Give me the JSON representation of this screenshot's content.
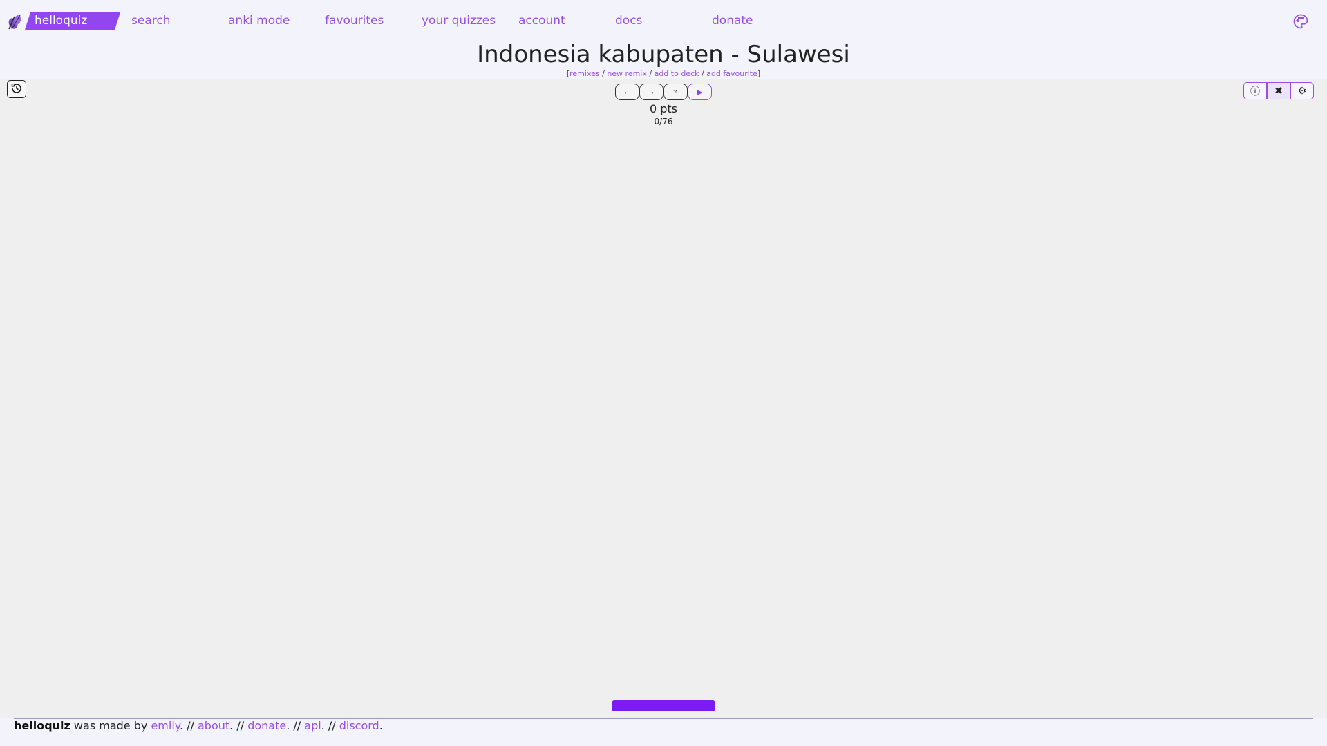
{
  "nav": {
    "brand": "helloquiz",
    "links": [
      "search",
      "anki mode",
      "favourites",
      "your quizzes",
      "account",
      "docs",
      "donate"
    ]
  },
  "quiz": {
    "title": "Indonesia kabupaten - Sulawesi",
    "links": {
      "open": "[",
      "remixes": "remixes",
      "sep1": " / ",
      "new_remix": "new remix",
      "sep2": " / ",
      "add_to_deck": "add to deck",
      "sep3": " / ",
      "add_favourite": "add favourite",
      "close": "]"
    },
    "controls": {
      "prev": "←",
      "next": "→",
      "skip": "»",
      "play": "▶"
    },
    "score": "0 pts",
    "progress": "0/76",
    "progress_value": 0,
    "progress_total": 76,
    "tools": {
      "info": "ⓘ",
      "close": "✖",
      "settings": "⚙"
    }
  },
  "footer": {
    "brand": "helloquiz",
    "made_by": " was made by ",
    "author": "emily",
    "s1": ". // ",
    "about": "about",
    "s2": ". // ",
    "donate": "donate",
    "s3": ". // ",
    "api": "api",
    "s4": ". // ",
    "discord": "discord",
    "end": "."
  },
  "colors": {
    "accent": "#9146f0",
    "link": "#9a4fe3",
    "page_bg": "#f3f3fc",
    "panel_bg": "#efefef",
    "answer_bar": "#7d1cf0"
  }
}
